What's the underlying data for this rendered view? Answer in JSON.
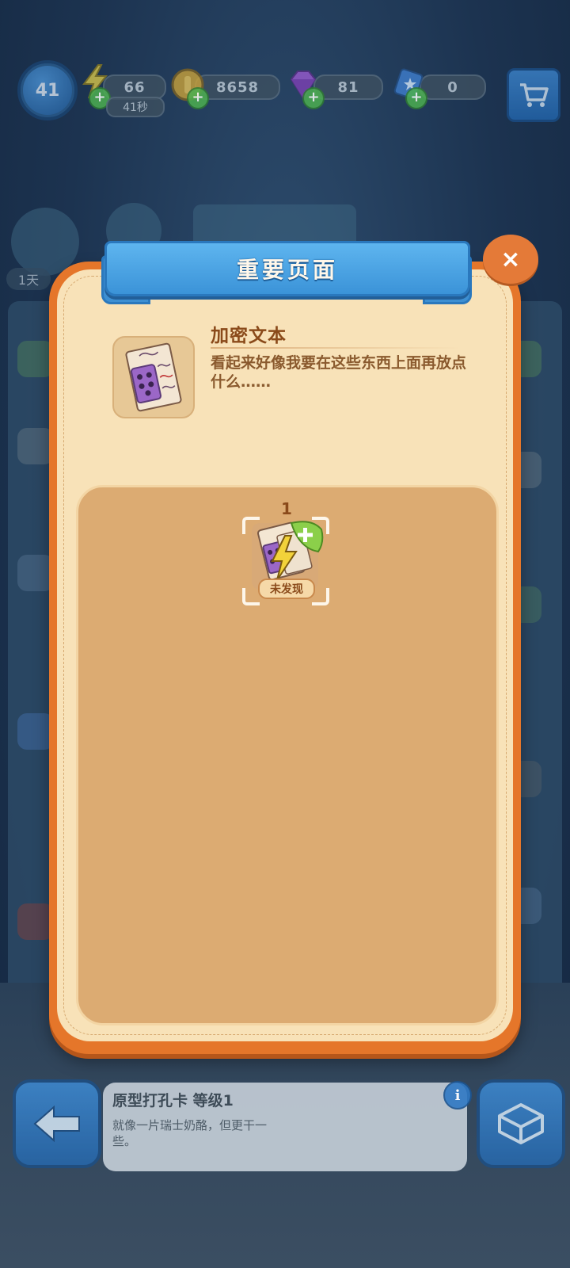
{
  "hud": {
    "level": "41",
    "energy": "66",
    "energy_timer": "41秒",
    "coins": "8658",
    "gems": "81",
    "cards": "0"
  },
  "background": {
    "timer_label": "1天"
  },
  "modal": {
    "title": "重要页面",
    "close_label": "×",
    "item": {
      "name": "加密文本",
      "description": "看起来好像我要在这些东西上面再放点什么……"
    },
    "slot": {
      "count": "1",
      "status": "未发现"
    }
  },
  "bottom": {
    "item_name": "原型打孔卡 等级1",
    "item_description": "就像一片瑞士奶酪，但更干一些。",
    "info_label": "i"
  },
  "colors": {
    "modal_orange": "#e5762a",
    "parchment": "#f8e2b8",
    "ribbon_blue": "#4aa3e3",
    "title_brown": "#8a4a1a",
    "plus_green": "#4caf50"
  },
  "icons": {
    "level": "level-badge-icon",
    "energy": "lightning-icon",
    "coins": "coin-icon",
    "gems": "gem-icon",
    "cards": "card-icon",
    "cart": "cart-icon",
    "back": "back-arrow-icon",
    "box": "box-icon",
    "close": "close-icon",
    "item": "punch-card-icon"
  }
}
